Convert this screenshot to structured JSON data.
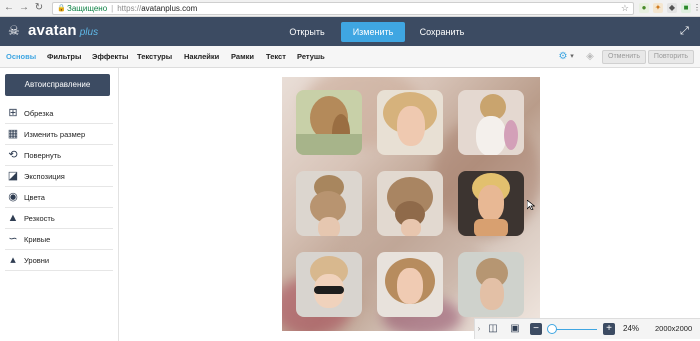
{
  "browser": {
    "secure_label": "Защищено",
    "url_prefix": "https://",
    "url_host": "avatanplus.com"
  },
  "app": {
    "logo_text": "avatan",
    "logo_plus": "plus",
    "header_buttons": [
      {
        "label": "Открыть"
      },
      {
        "label": "Изменить"
      },
      {
        "label": "Сохранить"
      }
    ]
  },
  "toolbar": {
    "tabs": [
      {
        "label": "Основы"
      },
      {
        "label": "Фильтры"
      },
      {
        "label": "Эффекты"
      },
      {
        "label": "Текстуры"
      },
      {
        "label": "Наклейки"
      },
      {
        "label": "Рамки"
      },
      {
        "label": "Текст"
      },
      {
        "label": "Ретушь"
      }
    ],
    "undo_label": "Отменить",
    "redo_label": "Повторить"
  },
  "sidebar": {
    "auto_label": "Автоисправление",
    "tools": [
      {
        "label": "Обрезка",
        "icon": "crop-icon"
      },
      {
        "label": "Изменить размер",
        "icon": "resize-icon"
      },
      {
        "label": "Повернуть",
        "icon": "rotate-icon"
      },
      {
        "label": "Экспозиция",
        "icon": "exposure-icon"
      },
      {
        "label": "Цвета",
        "icon": "palette-icon"
      },
      {
        "label": "Резкость",
        "icon": "sharpness-icon"
      },
      {
        "label": "Кривые",
        "icon": "curves-icon"
      },
      {
        "label": "Уровни",
        "icon": "levels-icon"
      }
    ]
  },
  "bottom_bar": {
    "zoom_value": "24%",
    "zoom_level": 0.24,
    "dimensions": "2000x2000"
  },
  "colors": {
    "header_bg": "#3c4b62",
    "accent": "#3fa6e2"
  }
}
